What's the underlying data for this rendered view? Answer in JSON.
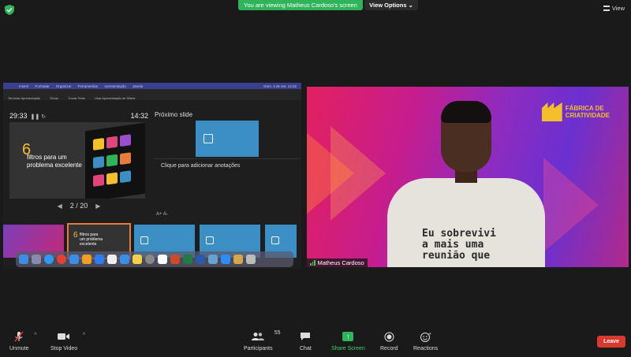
{
  "banner": {
    "text": "You are viewing Matheus Cardoso's screen"
  },
  "view_options": {
    "label": "View Options ⌄"
  },
  "view_button": {
    "label": "View"
  },
  "shared_screen": {
    "menubar": {
      "items": [
        "Inserir",
        "Formatar",
        "Organizar",
        "Ferramentas",
        "Apresentação",
        "Janela"
      ],
      "right": "Dom. 4 de set. 14:32"
    },
    "toolbar": [
      "Terminar Apresentação",
      "Obras",
      "Trocar Telas",
      "Usar Apresentação de Slides"
    ],
    "timer": "29:33",
    "clock": "14:32",
    "current_slide": {
      "number": "6",
      "text": "filtros para um problema excelente"
    },
    "slide_counter": "2 / 20",
    "next_label": "Próximo slide",
    "notes_placeholder": "Clique para adicionar anotações",
    "font_controls": "A+ A-",
    "thumb_slide2": {
      "number": "6",
      "text": "filtros para um problema excelente"
    }
  },
  "video": {
    "brand_line1": "FÁBRICA DE",
    "brand_line2": "CRIATIVIDADE",
    "shirt_text": [
      "Eu sobrevivi",
      "a mais uma",
      "reunião que"
    ],
    "participant_name": "Matheus Cardoso"
  },
  "toolbar": {
    "unmute": "Unmute",
    "stop_video": "Stop Video",
    "participants": "Participants",
    "participants_count": "55",
    "chat": "Chat",
    "share_screen": "Share Screen",
    "record": "Record",
    "reactions": "Reactions",
    "leave": "Leave"
  },
  "colors": {
    "banner_green": "#2fb45a",
    "leave_red": "#d93a30",
    "brand_yellow": "#f4c02a"
  }
}
